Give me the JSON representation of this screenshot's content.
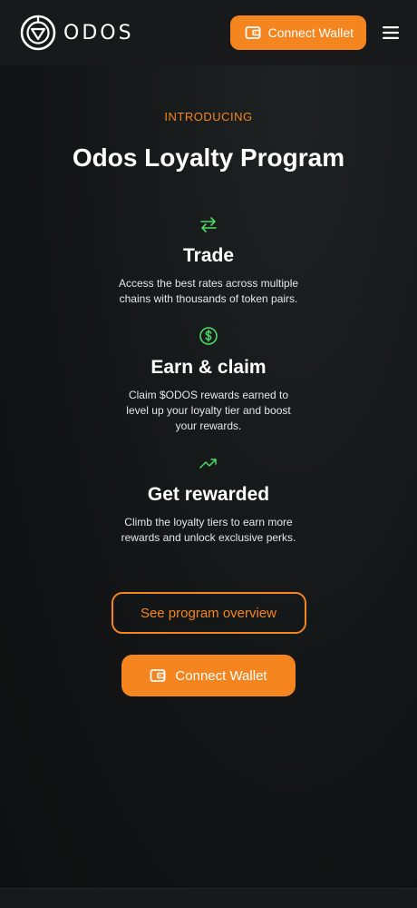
{
  "header": {
    "logo_text": "ODOS",
    "connect_label": "Connect Wallet",
    "menu_icon": "hamburger-icon",
    "logo_icon": "odos-logo-icon",
    "wallet_icon": "wallet-icon"
  },
  "hero": {
    "eyebrow": "INTRODUCING",
    "title": "Odos Loyalty Program"
  },
  "features": [
    {
      "icon": "swap-arrows-icon",
      "title": "Trade",
      "description": "Access the best rates across multiple chains with thousands of token pairs."
    },
    {
      "icon": "dollar-circle-icon",
      "title": "Earn & claim",
      "description": "Claim $ODOS rewards earned to level up your loyalty tier and boost your rewards."
    },
    {
      "icon": "trending-up-icon",
      "title": "Get rewarded",
      "description": "Climb the loyalty tiers to earn more rewards and unlock exclusive perks."
    }
  ],
  "actions": {
    "overview_label": "See program overview",
    "connect_label": "Connect Wallet"
  },
  "colors": {
    "accent": "#f5861f",
    "icon_green": "#4cd964",
    "background": "#121315",
    "header_bg": "#17191b"
  }
}
